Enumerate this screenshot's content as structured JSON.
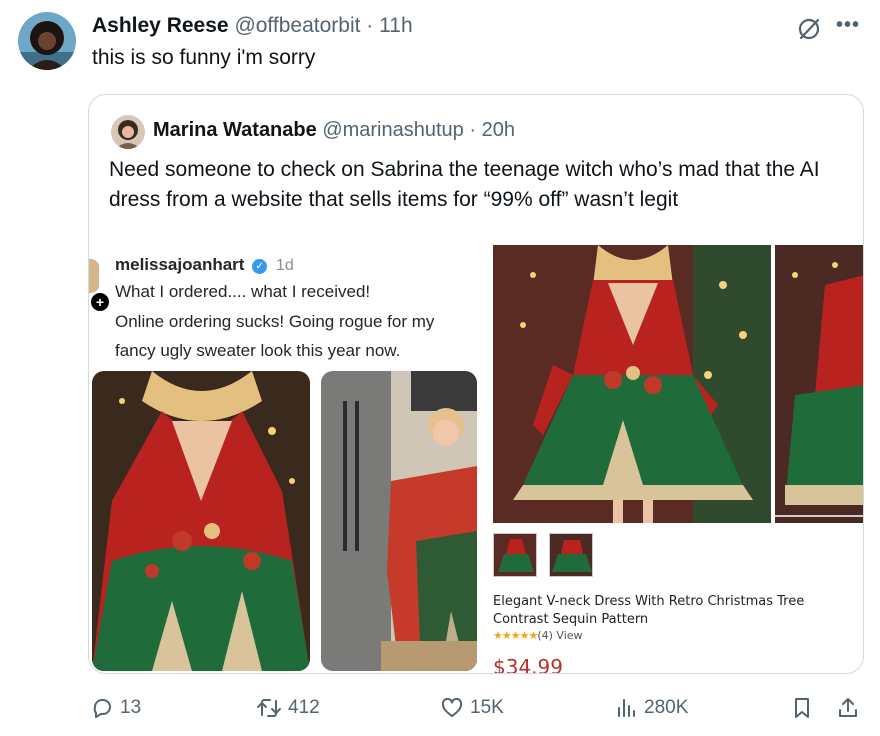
{
  "tweet": {
    "author_name": "Ashley Reese",
    "author_handle": "@offbeatorbit",
    "separator": "·",
    "time": "11h",
    "text": "this is so funny i'm sorry"
  },
  "quote": {
    "author_name": "Marina Watanabe",
    "author_handle": "@marinashutup",
    "separator": "·",
    "time": "20h",
    "text": "Need someone to check on Sabrina the teenage witch who’s mad that the AI dress from a website that sells items for “99% off” wasn’t legit"
  },
  "instagram": {
    "username": "melissajoanhart",
    "verified_mark": "✓",
    "time": "1d",
    "plus": "+",
    "caption_line1": "What I ordered.... what I received!",
    "caption_line2": "Online ordering sucks! Going rogue for my",
    "caption_line3": "fancy ugly sweater look this year now."
  },
  "product": {
    "title": "Elegant V-neck Dress With Retro Christmas Tree Contrast Sequin Pattern",
    "stars": "★★★★★",
    "review_count": "(4)",
    "view_label": "View",
    "price": "$34.99"
  },
  "actions": {
    "replies": "13",
    "reposts": "412",
    "likes": "15K",
    "views": "280K"
  },
  "colors": {
    "text_primary": "#0f1419",
    "text_secondary": "#536471",
    "border": "#cfd9de",
    "dress_red": "#b8231f",
    "dress_green": "#1f6b3a",
    "price_red": "#b8322a"
  },
  "icons": [
    "grok-icon",
    "more-icon",
    "reply-icon",
    "retweet-icon",
    "like-icon",
    "views-icon",
    "bookmark-icon",
    "share-icon",
    "verified-icon"
  ]
}
